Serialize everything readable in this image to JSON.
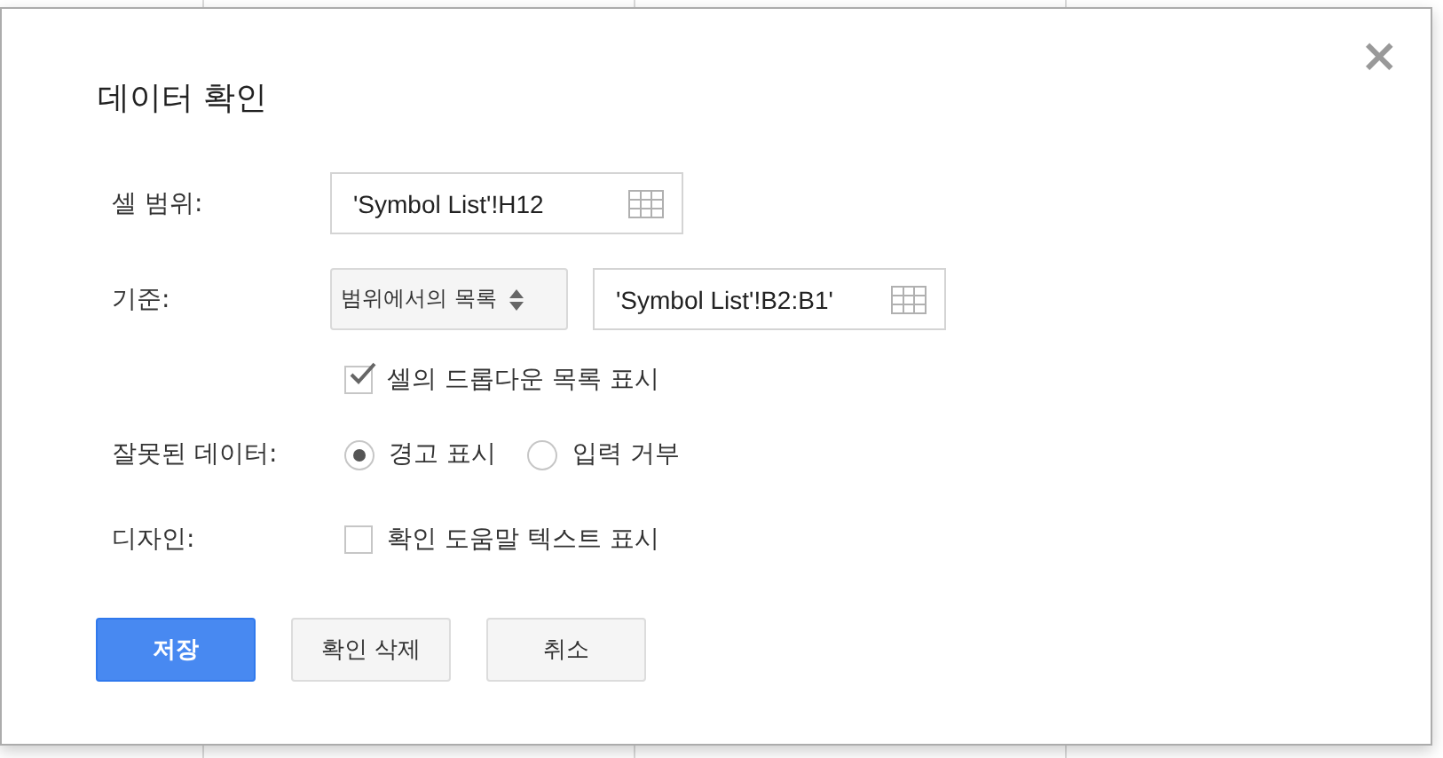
{
  "dialog": {
    "title": "데이터 확인",
    "close": "×"
  },
  "cell_range": {
    "label": "셀 범위:",
    "value": "'Symbol List'!H12"
  },
  "criteria": {
    "label": "기준:",
    "select": "범위에서의 목록",
    "value": "'Symbol List'!B2:B1'"
  },
  "show_dropdown": {
    "label": "셀의 드롭다운 목록 표시",
    "checked": true
  },
  "invalid_data": {
    "label": "잘못된 데이터:",
    "options": [
      {
        "label": "경고 표시",
        "selected": true
      },
      {
        "label": "입력 거부",
        "selected": false
      }
    ]
  },
  "appearance": {
    "label": "디자인:",
    "checkbox": {
      "label": "확인 도움말 텍스트 표시",
      "checked": false
    }
  },
  "buttons": [
    {
      "label": "저장",
      "kind": "primary"
    },
    {
      "label": "확인 삭제",
      "kind": "secondary"
    },
    {
      "label": "취소",
      "kind": "secondary"
    }
  ]
}
